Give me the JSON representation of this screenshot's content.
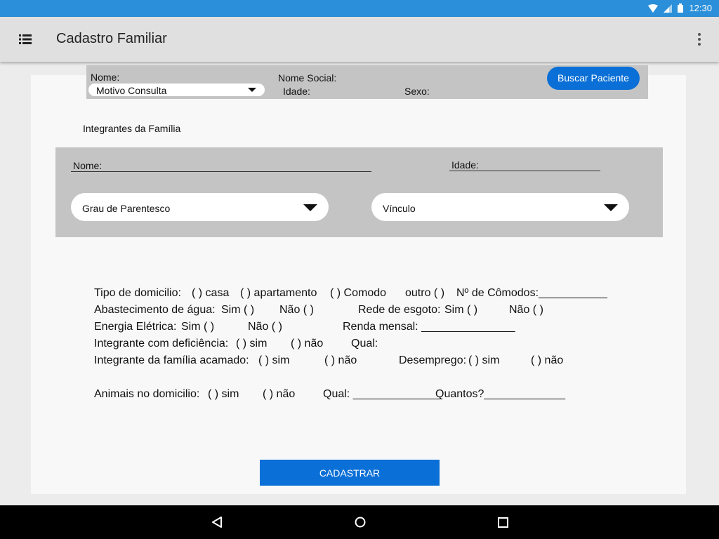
{
  "status_bar": {
    "time": "12:30",
    "icons": [
      "wifi-icon",
      "signal-icon",
      "battery-icon"
    ]
  },
  "app_bar": {
    "title": "Cadastro Familiar",
    "menu_icon": "list-menu-icon",
    "overflow_icon": "more-vert-icon"
  },
  "patient": {
    "name_label": "Nome:",
    "social_name_label": "Nome Social:",
    "consultation_select": "Motivo Consulta",
    "age_label": "Idade:",
    "sex_label": "Sexo:",
    "search_button": "Buscar Paciente"
  },
  "family": {
    "section_title": "Integrantes da Família",
    "name_label": "Nome:",
    "age_label": "Idade:",
    "kinship_select": "Grau de Parentesco",
    "bond_select": "Vínculo"
  },
  "form": {
    "domicilio": {
      "label": "Tipo de domicilio:",
      "casa": "(  ) casa",
      "apartamento": "(  )  apartamento",
      "comodo": "(  ) Comodo",
      "outro": "outro (  )",
      "comodos": "Nº de Cômodos:___________"
    },
    "agua": {
      "label": "Abastecimento de água:",
      "sim": "Sim (   )",
      "nao": "Não (   )"
    },
    "esgoto": {
      "label": "Rede de esgoto:",
      "sim": "Sim (  )",
      "nao": "Não (   )"
    },
    "energia": {
      "label": "Energia Elétrica:",
      "sim": "Sim (   )",
      "nao": "Não (  )"
    },
    "renda": {
      "label": "Renda mensal: _______________"
    },
    "deficiencia": {
      "label": "Integrante com deficiência:",
      "sim": "(   ) sim",
      "nao": "(   ) não",
      "qual": "Qual:"
    },
    "acamado": {
      "label": "Integrante da família acamado:",
      "sim": "(   ) sim",
      "nao": "(   ) não"
    },
    "desemprego": {
      "label": "Desemprego:",
      "sim": "(   ) sim",
      "nao": "(   ) não"
    },
    "animais": {
      "label": "Animais no domicilio:",
      "sim": "(  ) sim",
      "nao": "(   ) não",
      "qual": "Qual: ______________",
      "quantos": "Quantos?_____________"
    }
  },
  "actions": {
    "submit": "CADASTRAR"
  },
  "nav_bar": {
    "icons": [
      "back-icon",
      "home-icon",
      "recents-icon"
    ]
  },
  "colors": {
    "status_bar": "#2b90d9",
    "primary_button": "#0a6fd6",
    "panel": "#c4c4c4",
    "app_bar": "#e0e0e0"
  }
}
